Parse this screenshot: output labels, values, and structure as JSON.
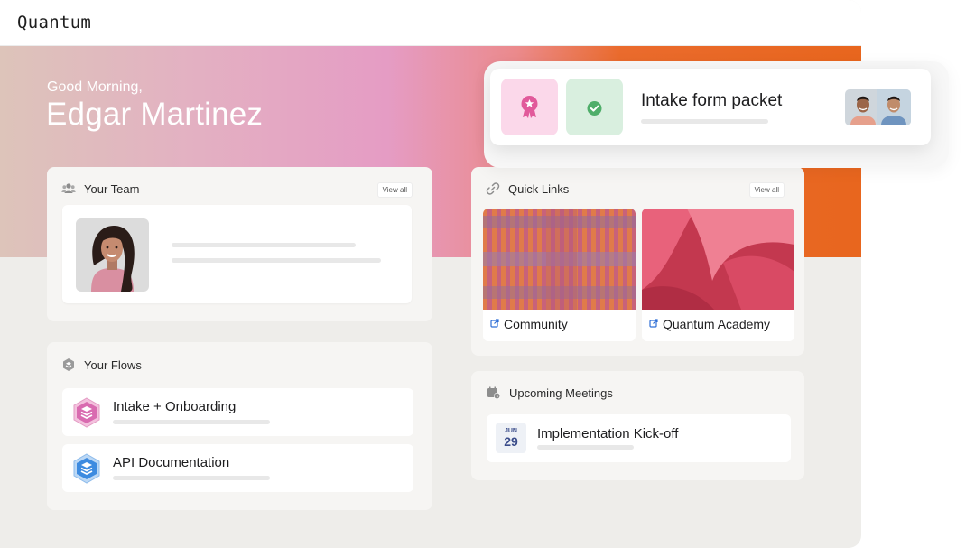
{
  "app": {
    "logo": "Quantum"
  },
  "hero": {
    "greeting": "Good Morning,",
    "user_name": "Edgar Martinez"
  },
  "floating_card": {
    "title": "Intake form packet",
    "icons": [
      "award-icon",
      "check-icon"
    ]
  },
  "team": {
    "title": "Your Team",
    "view_all": "View all"
  },
  "flows": {
    "title": "Your Flows",
    "items": [
      {
        "label": "Intake + Onboarding",
        "icon": "pink-layers-icon",
        "color": "#d96bb0"
      },
      {
        "label": "API Documentation",
        "icon": "blue-layers-icon",
        "color": "#3d8be0"
      }
    ]
  },
  "quick_links": {
    "title": "Quick Links",
    "view_all": "View all",
    "items": [
      {
        "label": "Community",
        "icon": "external-link-icon"
      },
      {
        "label": "Quantum Academy",
        "icon": "external-link-icon"
      }
    ]
  },
  "meetings": {
    "title": "Upcoming Meetings",
    "items": [
      {
        "month": "JUN",
        "day": "29",
        "label": "Implementation Kick-off"
      }
    ]
  },
  "colors": {
    "accent_orange": "#e8661e",
    "accent_pink": "#e59cc4",
    "date_blue": "#3a4c8a",
    "external_link_blue": "#2f6fd6"
  }
}
